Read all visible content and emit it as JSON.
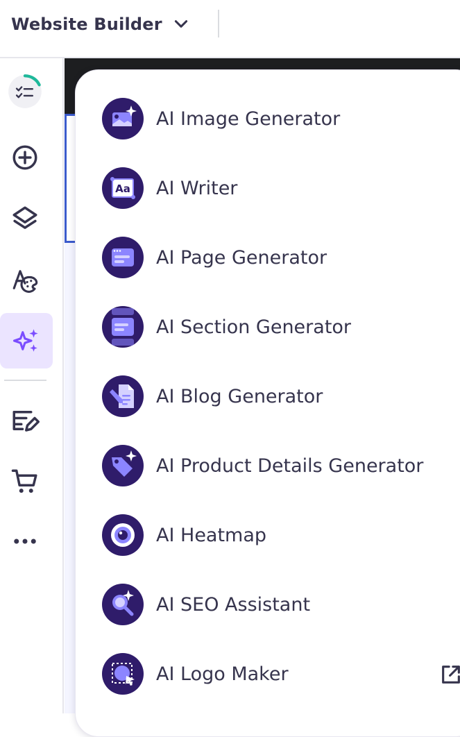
{
  "header": {
    "app_title": "Website Builder",
    "switcher_icon": "chevron-down-icon"
  },
  "rail": {
    "items": [
      {
        "name": "progress-checklist",
        "icon": "checklist-icon"
      },
      {
        "name": "add-elements",
        "icon": "plus-circle-icon"
      },
      {
        "name": "layers",
        "icon": "layers-icon"
      },
      {
        "name": "styles",
        "icon": "font-palette-icon"
      },
      {
        "name": "ai-tools",
        "icon": "sparkles-icon",
        "active": true
      },
      {
        "name": "blog",
        "icon": "edit-list-icon"
      },
      {
        "name": "store",
        "icon": "cart-icon"
      },
      {
        "name": "more",
        "icon": "more-icon"
      }
    ]
  },
  "ai_menu": {
    "items": [
      {
        "label": "AI Image Generator",
        "icon": "image-sparkle-icon"
      },
      {
        "label": "AI Writer",
        "icon": "text-aa-icon"
      },
      {
        "label": "AI Page Generator",
        "icon": "browser-page-icon"
      },
      {
        "label": "AI Section Generator",
        "icon": "section-icon"
      },
      {
        "label": "AI Blog Generator",
        "icon": "document-pencil-icon"
      },
      {
        "label": "AI Product Details Generator",
        "icon": "tag-sparkle-icon"
      },
      {
        "label": "AI Heatmap",
        "icon": "eye-icon"
      },
      {
        "label": "AI SEO Assistant",
        "icon": "search-sparkle-icon"
      },
      {
        "label": "AI Logo Maker",
        "icon": "logo-cursor-icon",
        "external": true,
        "external_icon": "external-link-icon"
      }
    ]
  },
  "colors": {
    "icon_bg": "#2f1c6a",
    "accent": "#8c85ff",
    "active_bg": "#ebe4ff",
    "text": "#36344d"
  }
}
